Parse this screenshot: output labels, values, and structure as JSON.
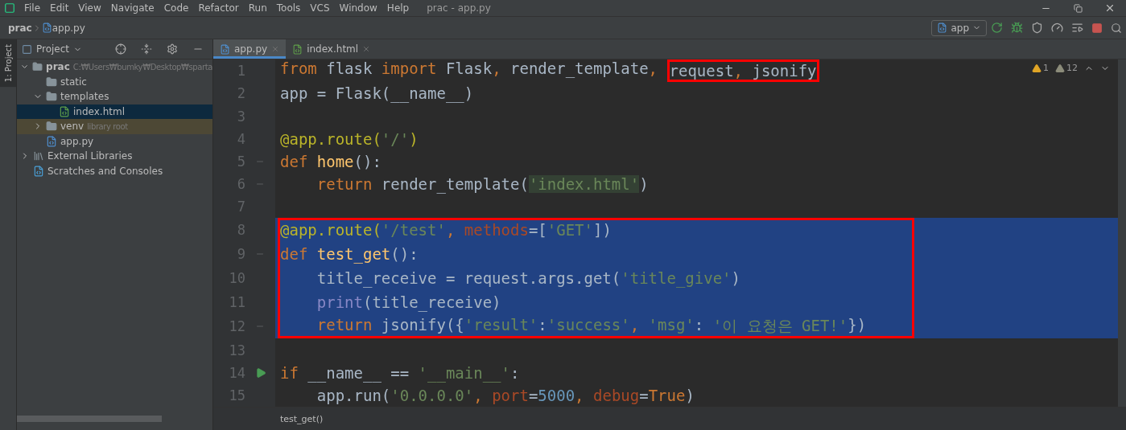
{
  "window": {
    "title": "prac - app.py",
    "menu": [
      "File",
      "Edit",
      "View",
      "Navigate",
      "Code",
      "Refactor",
      "Run",
      "Tools",
      "VCS",
      "Window",
      "Help"
    ]
  },
  "navbar": {
    "breadcrumb": [
      "prac",
      "app.py"
    ],
    "run_config": "app"
  },
  "side_stripe": {
    "label": "1: Project"
  },
  "project": {
    "title": "Project",
    "tree": [
      {
        "name": "prac",
        "hint": "C:₩Users₩bumky₩Desktop₩sparta",
        "kind": "folder",
        "expanded": true,
        "selected": false,
        "children": [
          {
            "name": "static",
            "kind": "folder",
            "selected": false
          },
          {
            "name": "templates",
            "kind": "folder",
            "expanded": true,
            "selected": false,
            "children": [
              {
                "name": "index.html",
                "kind": "html",
                "selected": true
              }
            ]
          },
          {
            "name": "venv",
            "hint": "library root",
            "kind": "folder",
            "expanded": false,
            "highlighted": true,
            "selected": false
          },
          {
            "name": "app.py",
            "kind": "python",
            "selected": false
          }
        ]
      },
      {
        "name": "External Libraries",
        "kind": "libraries",
        "expanded": false,
        "selected": false
      },
      {
        "name": "Scratches and Consoles",
        "kind": "scratches",
        "selected": false
      }
    ]
  },
  "editor": {
    "tabs": [
      {
        "label": "app.py",
        "kind": "python",
        "selected": true
      },
      {
        "label": "index.html",
        "kind": "html",
        "selected": false
      }
    ],
    "warnings": [
      {
        "count": "1",
        "color": "#e0a526"
      },
      {
        "count": "12",
        "color": "#8c8c7a"
      }
    ],
    "lines": [
      {
        "number": "1",
        "kind": "plain",
        "selected": false,
        "boxed": false,
        "tokens": [
          {
            "kind": "kw",
            "text": "from "
          },
          {
            "kind": "plain",
            "text": "flask "
          },
          {
            "kind": "kw",
            "text": "import "
          },
          {
            "kind": "plain",
            "text": "Flask"
          },
          {
            "kind": "kw",
            "text": ", "
          },
          {
            "kind": "plain",
            "text": "render_template"
          },
          {
            "kind": "kw",
            "text": ", "
          },
          {
            "kind": "plain",
            "text": "request",
            "boxed": true
          },
          {
            "kind": "kw",
            "text": ", ",
            "boxed": true
          },
          {
            "kind": "plain",
            "text": "jsonify",
            "boxed": true
          }
        ]
      },
      {
        "number": "2",
        "kind": "plain",
        "selected": false,
        "boxed": false,
        "tokens": [
          {
            "kind": "plain",
            "text": "app = Flask(__name__)"
          }
        ]
      },
      {
        "number": "3",
        "kind": "plain",
        "selected": false,
        "boxed": false
      },
      {
        "number": "4",
        "kind": "plain",
        "selected": false,
        "boxed": false,
        "tokens": [
          {
            "kind": "deco",
            "text": "@app.route("
          },
          {
            "kind": "str",
            "text": "'/'"
          },
          {
            "kind": "deco",
            "text": ")"
          }
        ]
      },
      {
        "number": "5",
        "kind": "fold",
        "selected": false,
        "boxed": false,
        "tokens": [
          {
            "kind": "kw",
            "text": "def "
          },
          {
            "kind": "fn",
            "text": "home"
          },
          {
            "kind": "plain",
            "text": "():"
          }
        ]
      },
      {
        "number": "6",
        "kind": "fold",
        "selected": false,
        "boxed": false,
        "tokens": [
          {
            "kind": "kw",
            "text": "    return "
          },
          {
            "kind": "plain",
            "text": "render_template("
          },
          {
            "kind": "strhl",
            "text": "'index.html'"
          },
          {
            "kind": "plain",
            "text": ")"
          }
        ]
      },
      {
        "number": "7",
        "kind": "plain",
        "selected": false,
        "boxed": false
      },
      {
        "number": "8",
        "kind": "plain",
        "selected": true,
        "boxed": true,
        "tokens": [
          {
            "kind": "deco",
            "text": "@app.route("
          },
          {
            "kind": "str",
            "text": "'/test'"
          },
          {
            "kind": "kw",
            "text": ", "
          },
          {
            "kind": "param",
            "text": "methods"
          },
          {
            "kind": "plain",
            "text": "=["
          },
          {
            "kind": "str",
            "text": "'GET'"
          },
          {
            "kind": "plain",
            "text": "])"
          }
        ]
      },
      {
        "number": "9",
        "kind": "fold",
        "selected": true,
        "boxed": true,
        "tokens": [
          {
            "kind": "kw",
            "text": "def "
          },
          {
            "kind": "fn",
            "text": "test_get"
          },
          {
            "kind": "plain",
            "text": "():"
          }
        ]
      },
      {
        "number": "10",
        "kind": "plain",
        "selected": true,
        "boxed": true,
        "tokens": [
          {
            "kind": "plain",
            "text": "    title_receive = request.args.get("
          },
          {
            "kind": "str",
            "text": "'title_give'"
          },
          {
            "kind": "plain",
            "text": ")"
          }
        ]
      },
      {
        "number": "11",
        "kind": "plain",
        "selected": true,
        "boxed": true,
        "tokens": [
          {
            "kind": "builtin",
            "text": "    print"
          },
          {
            "kind": "plain",
            "text": "(title_receive)"
          }
        ]
      },
      {
        "number": "12",
        "kind": "fold",
        "selected": true,
        "boxed": true,
        "tokens": [
          {
            "kind": "kw",
            "text": "    return "
          },
          {
            "kind": "plain",
            "text": "jsonify({"
          },
          {
            "kind": "str",
            "text": "'result'"
          },
          {
            "kind": "plain",
            "text": ":"
          },
          {
            "kind": "str",
            "text": "'success'"
          },
          {
            "kind": "kw",
            "text": ", "
          },
          {
            "kind": "str",
            "text": "'msg'"
          },
          {
            "kind": "plain",
            "text": ": "
          },
          {
            "kind": "str",
            "text": "'이 요청은 GET!'"
          },
          {
            "kind": "plain",
            "text": "})"
          }
        ]
      },
      {
        "number": "13",
        "kind": "plain",
        "selected": false,
        "boxed": false
      },
      {
        "number": "14",
        "kind": "run",
        "selected": false,
        "boxed": false,
        "tokens": [
          {
            "kind": "kw",
            "text": "if "
          },
          {
            "kind": "plain",
            "text": "__name__ == "
          },
          {
            "kind": "str",
            "text": "'__main__'"
          },
          {
            "kind": "plain",
            "text": ":"
          }
        ]
      },
      {
        "number": "15",
        "kind": "plain",
        "selected": false,
        "boxed": false,
        "tokens": [
          {
            "kind": "plain",
            "text": "    app.run("
          },
          {
            "kind": "str",
            "text": "'0.0.0.0'"
          },
          {
            "kind": "kw",
            "text": ", "
          },
          {
            "kind": "param",
            "text": "port"
          },
          {
            "kind": "plain",
            "text": "="
          },
          {
            "kind": "num",
            "text": "5000"
          },
          {
            "kind": "kw",
            "text": ", "
          },
          {
            "kind": "param",
            "text": "debug"
          },
          {
            "kind": "plain",
            "text": "="
          },
          {
            "kind": "kw",
            "text": "True"
          },
          {
            "kind": "plain",
            "text": ")"
          }
        ]
      }
    ],
    "breadcrumb": "test_get()"
  }
}
